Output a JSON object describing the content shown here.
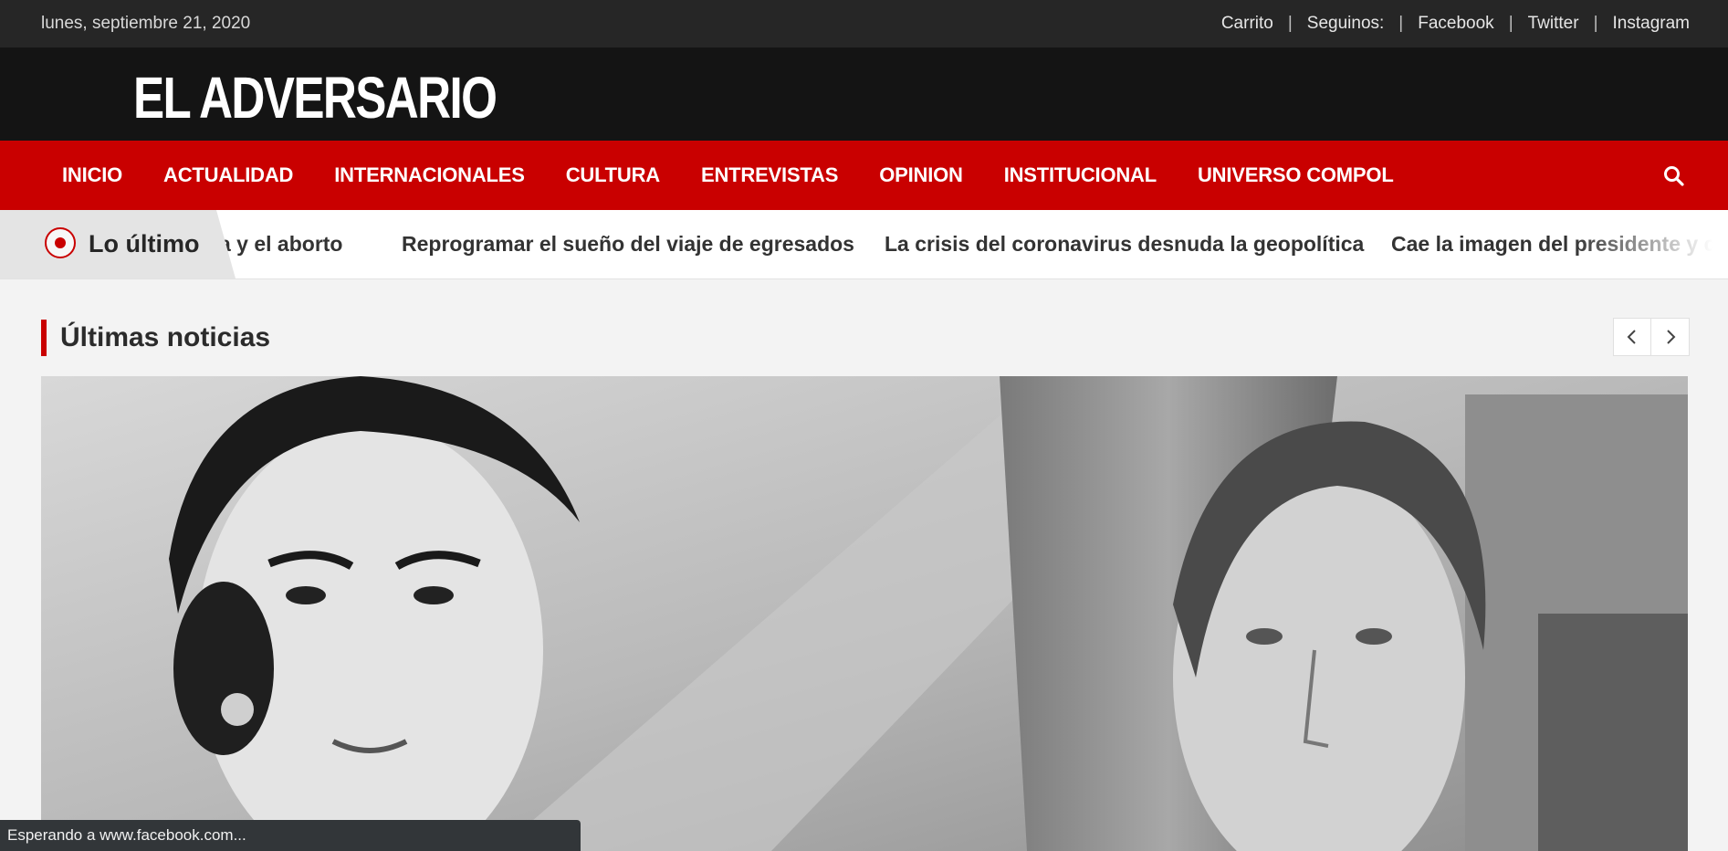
{
  "topbar": {
    "date": "lunes, septiembre 21, 2020",
    "links": [
      "Carrito",
      "Seguinos:",
      "Facebook",
      "Twitter",
      "Instagram"
    ]
  },
  "masthead": {
    "logo": "EL ADVERSARIO"
  },
  "nav": {
    "items": [
      "INICIO",
      "ACTUALIDAD",
      "INTERNACIONALES",
      "CULTURA",
      "ENTREVISTAS",
      "OPINION",
      "INSTITUCIONAL",
      "UNIVERSO COMPOL"
    ],
    "search_icon": "search-icon"
  },
  "ticker": {
    "label": "Lo último",
    "items": [
      "a y el aborto",
      "Reprogramar el sueño del viaje de egresados",
      "La crisis del coronavirus desnuda la geopolítica",
      "Cae la imagen del presidente y c"
    ]
  },
  "section": {
    "title": "Últimas noticias",
    "prev_icon": "chevron-left-icon",
    "next_icon": "chevron-right-icon"
  },
  "statusbar": {
    "text": "Esperando a www.facebook.com..."
  },
  "colors": {
    "accent": "#c90000",
    "topbar": "#262626",
    "masthead": "#141414"
  }
}
